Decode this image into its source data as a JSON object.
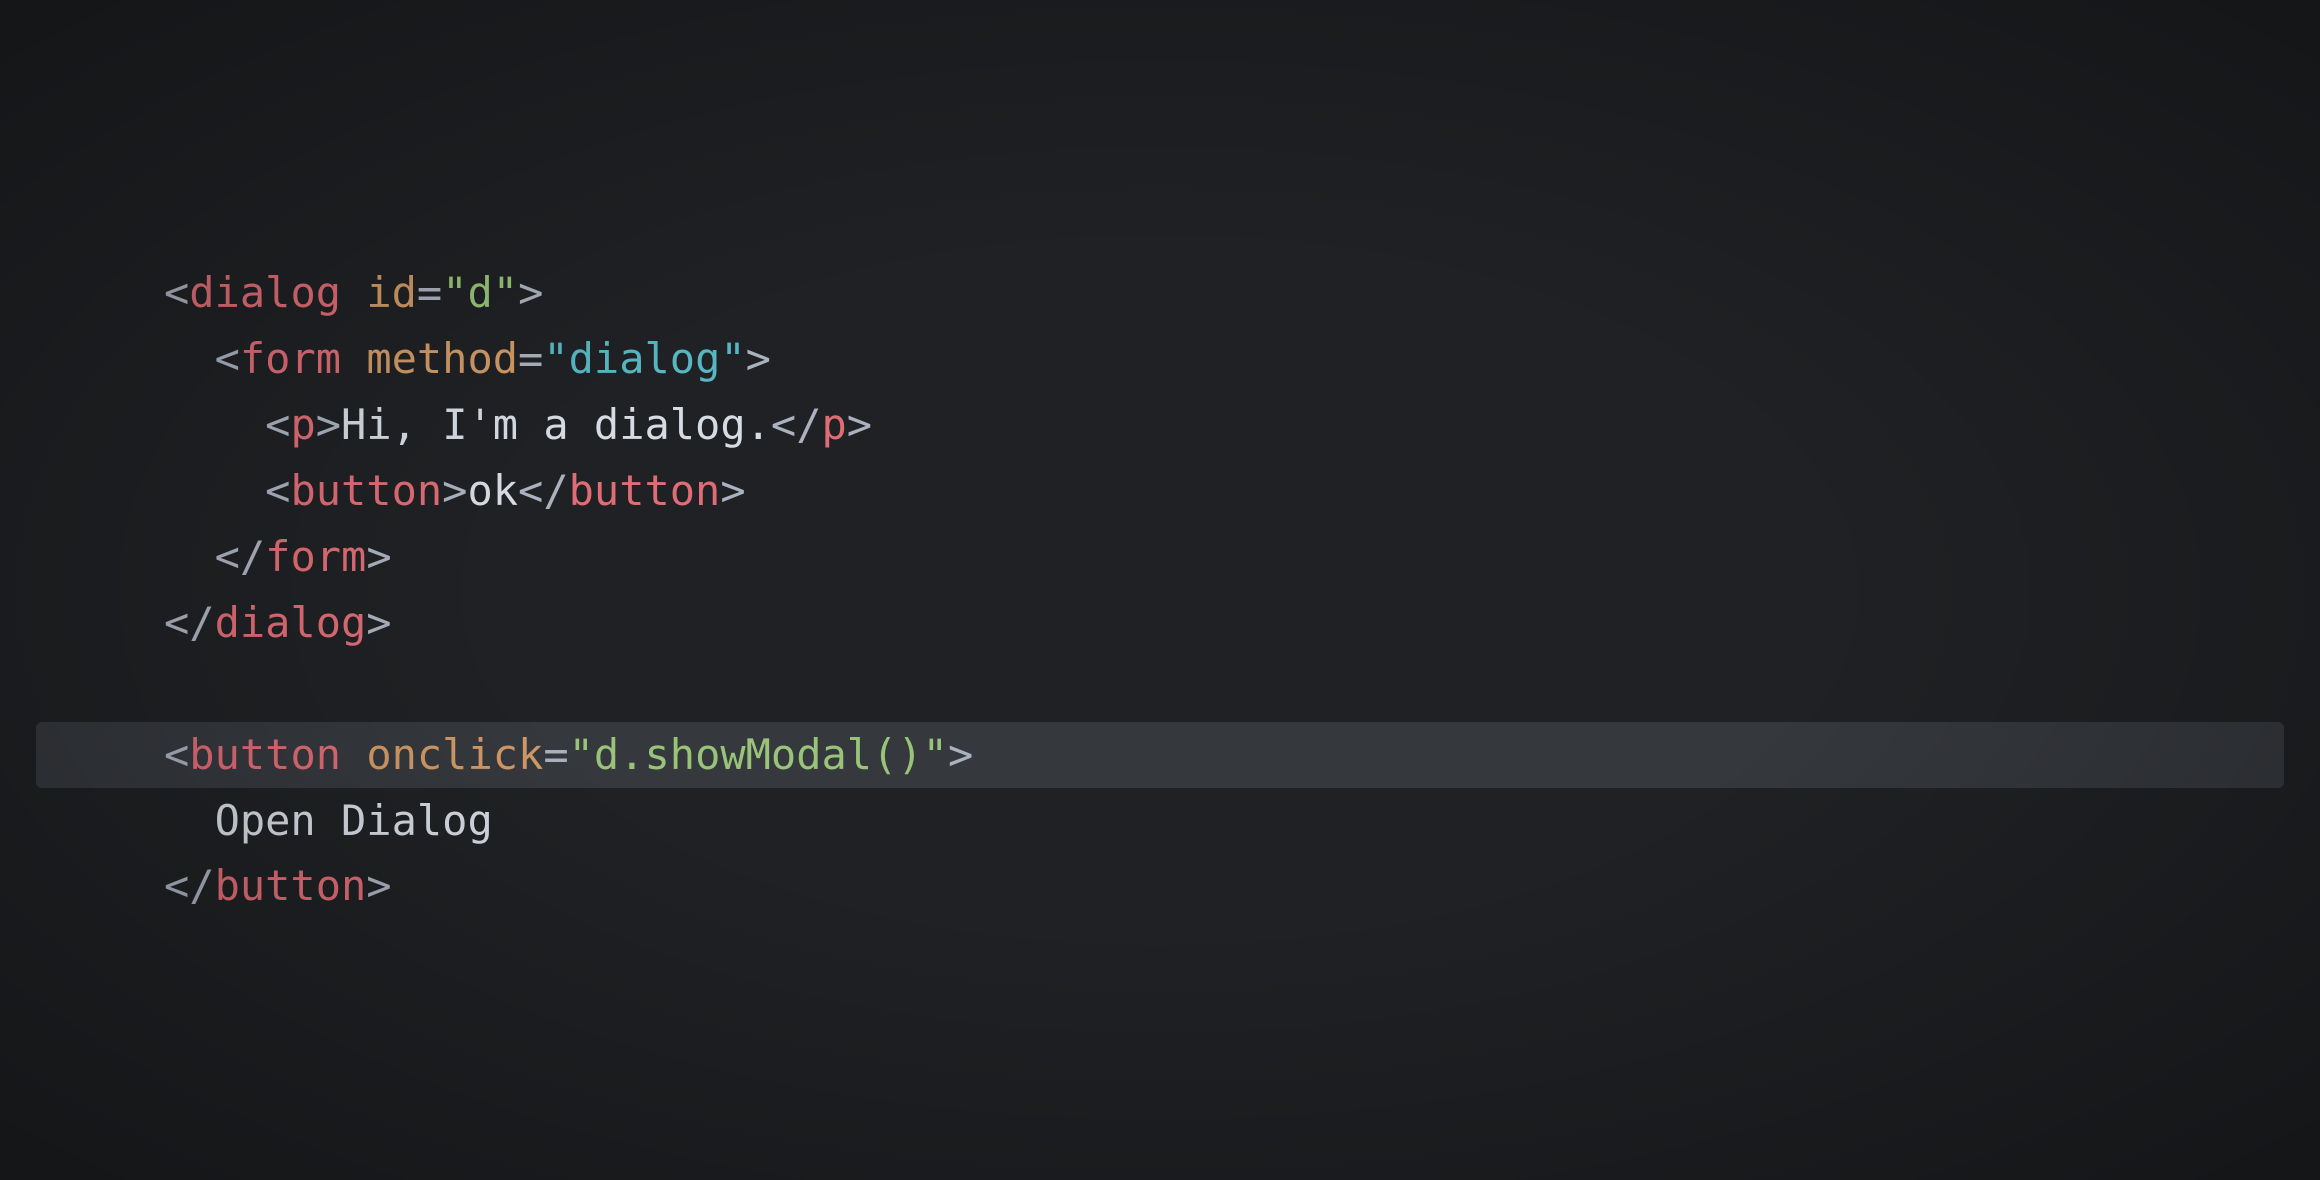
{
  "code": {
    "line1": {
      "open": "<",
      "tag": "dialog",
      "space": " ",
      "attr": "id",
      "eq": "=",
      "q1": "\"",
      "val": "d",
      "q2": "\"",
      "close": ">"
    },
    "line2": {
      "indent": "  ",
      "open": "<",
      "tag": "form",
      "space": " ",
      "attr": "method",
      "eq": "=",
      "q1": "\"",
      "val": "dialog",
      "q2": "\"",
      "close": ">"
    },
    "line3": {
      "indent": "    ",
      "open": "<",
      "tag": "p",
      "close": ">",
      "text": "Hi, I'm a dialog.",
      "open2": "</",
      "tag2": "p",
      "close2": ">"
    },
    "line4": {
      "indent": "    ",
      "open": "<",
      "tag": "button",
      "close": ">",
      "text": "ok",
      "open2": "</",
      "tag2": "button",
      "close2": ">"
    },
    "line5": {
      "indent": "  ",
      "open": "</",
      "tag": "form",
      "close": ">"
    },
    "line6": {
      "open": "</",
      "tag": "dialog",
      "close": ">"
    },
    "line7": " ",
    "line8": {
      "open": "<",
      "tag": "button",
      "space": " ",
      "attr": "onclick",
      "eq": "=",
      "q1": "\"",
      "val": "d.showModal()",
      "q2": "\"",
      "close": ">"
    },
    "line9": {
      "indent": "  ",
      "text": "Open Dialog"
    },
    "line10": {
      "open": "</",
      "tag": "button",
      "close": ">"
    }
  }
}
